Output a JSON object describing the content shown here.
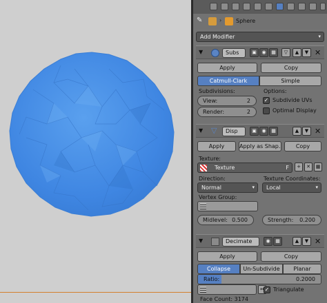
{
  "header": {
    "object_name": "Sphere"
  },
  "add_modifier": "Add Modifier",
  "subsurf": {
    "name": "Subs",
    "apply": "Apply",
    "copy": "Copy",
    "catmull": "Catmull-Clark",
    "simple": "Simple",
    "subdivisions_label": "Subdivisions:",
    "options_label": "Options:",
    "view_label": "View:",
    "view_value": "2",
    "render_label": "Render:",
    "render_value": "2",
    "subdivide_uvs": "Subdivide UVs",
    "optimal_display": "Optimal Display"
  },
  "displace": {
    "name": "Disp",
    "apply": "Apply",
    "apply_shape": "Apply as Shap...",
    "copy": "Copy",
    "texture_label": "Texture:",
    "texture_value": "Texture",
    "texture_flag": "F",
    "direction_label": "Direction:",
    "direction_value": "Normal",
    "texcoords_label": "Texture Coordinates:",
    "texcoords_value": "Local",
    "vertex_group_label": "Vertex Group:",
    "midlevel_label": "Midlevel:",
    "midlevel_value": "0.500",
    "strength_label": "Strength:",
    "strength_value": "0.200"
  },
  "decimate": {
    "name": "Decimate",
    "apply": "Apply",
    "copy": "Copy",
    "collapse": "Collapse",
    "unsubdivide": "Un-Subdivide",
    "planar": "Planar",
    "ratio_label": "Ratio:",
    "ratio_value": "0.2000",
    "triangulate": "Triangulate",
    "face_count": "Face Count: 3174"
  },
  "colors": {
    "sphere": "#4a8fe6",
    "accent": "#5680c2",
    "panel": "#737373"
  }
}
